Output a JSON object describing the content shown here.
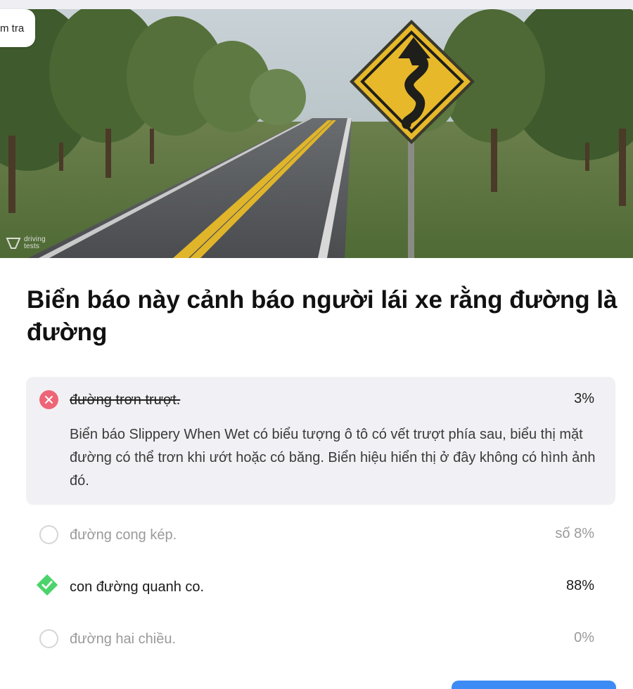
{
  "badge": {
    "label": "m tra"
  },
  "watermark": {
    "line1": "driving",
    "line2": "tests"
  },
  "question": {
    "text": "Biển báo này cảnh báo người lái xe rằng đường là đường"
  },
  "options": [
    {
      "label": "đường trơn trượt.",
      "percent": "3%",
      "state": "wrong",
      "explanation": "Biển báo Slippery When Wet có biểu tượng ô tô có vết trượt phía sau, biểu thị mặt đường có thể trơn khi ướt hoặc có băng. Biển hiệu hiển thị ở đây không có hình ảnh đó."
    },
    {
      "label": "đường cong kép.",
      "percent": "số 8%",
      "state": "unselected"
    },
    {
      "label": "con đường quanh co.",
      "percent": "88%",
      "state": "correct"
    },
    {
      "label": "đường hai chiều.",
      "percent": "0%",
      "state": "unselected"
    }
  ],
  "colors": {
    "wrong_icon": "#ee6577",
    "correct_icon": "#4cd36b",
    "sign_yellow": "#e7b82a",
    "button_blue": "#3d8bf5",
    "wrong_bg": "#f1f1f5"
  },
  "icons": {
    "wrong": "close-icon",
    "correct": "checkmark-icon",
    "unselected": "radio-circle-icon",
    "sign": "winding-road-sign-icon"
  }
}
